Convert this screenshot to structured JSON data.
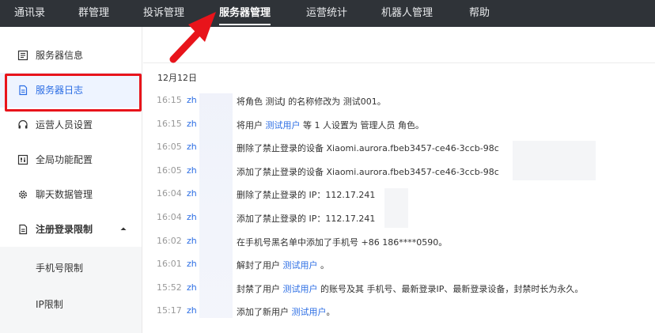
{
  "nav": {
    "items": [
      {
        "label": "通讯录"
      },
      {
        "label": "群管理"
      },
      {
        "label": "投诉管理"
      },
      {
        "label": "服务器管理",
        "active": true
      },
      {
        "label": "运营统计"
      },
      {
        "label": "机器人管理"
      },
      {
        "label": "帮助"
      }
    ]
  },
  "sidebar": {
    "items": [
      {
        "label": "服务器信息",
        "icon": "server-info-icon"
      },
      {
        "label": "服务器日志",
        "icon": "document-icon",
        "active": true
      },
      {
        "label": "运营人员设置",
        "icon": "headset-icon"
      },
      {
        "label": "全局功能配置",
        "icon": "settings-panel-icon"
      },
      {
        "label": "聊天数据管理",
        "icon": "gear-icon"
      },
      {
        "label": "注册登录限制",
        "icon": "document-icon",
        "expanded": true
      }
    ],
    "sub_items": [
      {
        "label": "手机号限制"
      },
      {
        "label": "IP限制"
      }
    ]
  },
  "log": {
    "date": "12月12日",
    "entries": [
      {
        "time": "16:15",
        "user": "zh",
        "msg": "将角色 测试J 的名称修改为 测试001。"
      },
      {
        "time": "16:15",
        "user": "zh",
        "msg_parts": [
          {
            "t": "将用户 "
          },
          {
            "t": "测试用户",
            "link": true
          },
          {
            "t": " 等 1 人设置为 管理人员 角色。"
          }
        ]
      },
      {
        "time": "16:05",
        "user": "zh",
        "msg": "删除了禁止登录的设备 Xiaomi.aurora.fbeb3457-ce46-3ccb-98c"
      },
      {
        "time": "16:05",
        "user": "zh",
        "msg": "添加了禁止登录的设备 Xiaomi.aurora.fbeb3457-ce46-3ccb-98c"
      },
      {
        "time": "16:04",
        "user": "zh",
        "msg": "删除了禁止登录的 IP：112.17.241"
      },
      {
        "time": "16:04",
        "user": "zh",
        "msg": "添加了禁止登录的 IP：112.17.241"
      },
      {
        "time": "16:02",
        "user": "zh",
        "msg": "在手机号黑名单中添加了手机号 +86 186****0590。"
      },
      {
        "time": "16:01",
        "user": "zh",
        "msg_parts": [
          {
            "t": "解封了用户 "
          },
          {
            "t": "测试用户",
            "link": true
          },
          {
            "t": " 。"
          }
        ]
      },
      {
        "time": "15:52",
        "user": "zh",
        "msg_parts": [
          {
            "t": "封禁了用户 "
          },
          {
            "t": "测试用户",
            "link": true
          },
          {
            "t": " 的账号及其 手机号、最新登录IP、最新登录设备，封禁时长为永久。"
          }
        ]
      },
      {
        "time": "15:17",
        "user": "zh",
        "msg_parts": [
          {
            "t": "添加了新用户 "
          },
          {
            "t": "测试用户",
            "link": true
          },
          {
            "t": "。"
          }
        ]
      }
    ]
  },
  "colors": {
    "nav_bg": "#2f3338",
    "accent": "#2b6de4",
    "highlight": "#e8141b"
  }
}
